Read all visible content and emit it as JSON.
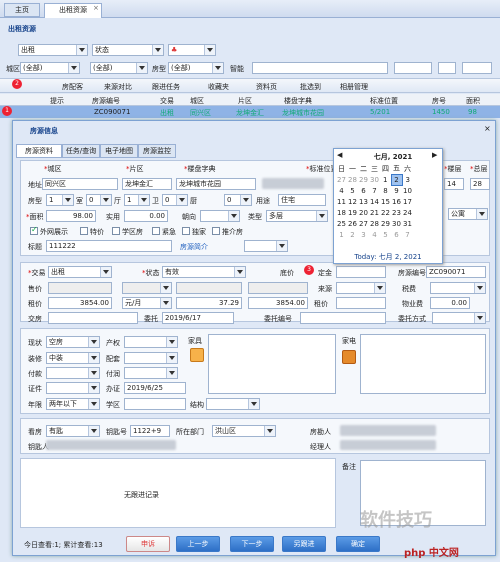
{
  "tabs": [
    "主页",
    "出租资源"
  ],
  "section_title": "出租资源",
  "filter": {
    "type": "出租",
    "status": "状态",
    "district": "(全部)",
    "area": "(全部)",
    "housetype": "(全部)",
    "smart_label": "智能",
    "district_label": "城区",
    "area_label": "片区",
    "house_label": "房型"
  },
  "toolbar": [
    "房配客",
    "来源对比",
    "跟进任务",
    "收藏夹",
    "资料页",
    "批选到",
    "相册管理"
  ],
  "grid": {
    "headers": [
      "提示",
      "房源编号",
      "交易",
      "城区",
      "片区",
      "楼盘字典",
      "标准位置",
      "房号",
      "面积"
    ],
    "row": {
      "code": "ZC090071",
      "trade": "出租",
      "district": "同兴区",
      "area": "龙坤金汇",
      "estate": "龙坤城市花园",
      "pos": "5/201",
      "room": "1450",
      "size": "98"
    }
  },
  "badges": [
    "1",
    "2",
    "3"
  ],
  "dialog": {
    "title": "房源信息",
    "tabs": [
      "房源资料",
      "任务/查询",
      "电子地图",
      "房源监控"
    ],
    "labels": {
      "district": "城区",
      "area": "片区",
      "estate": "楼盘字典",
      "standard_pos": "标准位置",
      "address": "地址",
      "unit": "单元",
      "room": "房号",
      "floor": "楼层",
      "total_floor": "总层",
      "housetype": "房型",
      "room_u": "室",
      "hall": "厅",
      "toilet": "卫",
      "kitchen": "厨",
      "balcony": "阳台",
      "usage": "用途",
      "size": "面积",
      "actual": "实用",
      "direction": "朝向",
      "type": "类型",
      "title": "标题",
      "intro": "房源简介"
    },
    "values": {
      "district": "同兴区",
      "area": "龙坤金汇",
      "estate": "龙坤城市花园",
      "floor": "14",
      "total_floor": "28",
      "rooms": "1",
      "halls": "0",
      "toilets": "1",
      "kitchens": "0",
      "balcony": "0",
      "usage": "住宅",
      "size": "98.00",
      "actual": "0.00",
      "direction": "",
      "type": "多层",
      "title": "111222",
      "decoration": "公寓"
    },
    "checks": [
      "外网展示",
      "特价",
      "学区房",
      "紧急",
      "独家",
      "推介房"
    ],
    "trade": {
      "trade_label": "交易",
      "trade": "出租",
      "status_label": "状态",
      "status": "有效",
      "price_label": "售价",
      "rent_label": "租价",
      "rent": "3854.00",
      "unit": "元/月",
      "unit_price": "37.29",
      "rent2": "3854.00",
      "deal_label": "交房",
      "commission_label": "委托",
      "commission": "2019/6/17",
      "commission_no_label": "委托编号",
      "commission_method_label": "委托方式",
      "code_label": "房源编号",
      "code": "ZC090071",
      "source_label": "来源",
      "tax_label": "税费",
      "mgmt_label": "物业费",
      "mgmt": "0.00",
      "deposit_label": "定金",
      "rent_price_label": "租价",
      "reserved_label": "底价"
    },
    "detail": {
      "status_label": "现状",
      "status": "空房",
      "property_label": "产权",
      "deco_label": "装修",
      "deco": "中装",
      "config_label": "配套",
      "payment_label": "付款",
      "furniture_label": "家具",
      "cert_label": "证件",
      "office_label": "办证",
      "office": "2019/6/25",
      "period_label": "年限",
      "period": "两年以下",
      "school_label": "学区",
      "structure_label": "结构",
      "appliance_label": "家电",
      "road_label": "付润"
    },
    "contact": {
      "key_label": "看房",
      "key": "有匙",
      "key_no_label": "钥匙号",
      "key_no": "1122+9",
      "dept_label": "所在部门",
      "dept": "洪山区",
      "owner_label": "房勘人",
      "agent_label": "钥匙人",
      "recorder_label": "经理人"
    },
    "note_label": "备注",
    "no_followup": "无跟进记录",
    "footer": "今日查看:1; 累计查看:13",
    "buttons": [
      "申诉",
      "上一步",
      "下一步",
      "另跟进",
      "确定"
    ]
  },
  "calendar": {
    "title": "七月, 2021",
    "weekdays": [
      "日",
      "一",
      "二",
      "三",
      "四",
      "五",
      "六"
    ],
    "today": "Today: 七月 2, 2021",
    "weeks": [
      [
        "27",
        "28",
        "29",
        "30",
        "1",
        "2",
        "3"
      ],
      [
        "4",
        "5",
        "6",
        "7",
        "8",
        "9",
        "10"
      ],
      [
        "11",
        "12",
        "13",
        "14",
        "15",
        "16",
        "17"
      ],
      [
        "18",
        "19",
        "20",
        "21",
        "22",
        "23",
        "24"
      ],
      [
        "25",
        "26",
        "27",
        "28",
        "29",
        "30",
        "31"
      ],
      [
        "1",
        "2",
        "3",
        "4",
        "5",
        "6",
        "7"
      ]
    ],
    "selected": "2"
  },
  "watermark": "软件技巧",
  "brand": "php 中文网"
}
